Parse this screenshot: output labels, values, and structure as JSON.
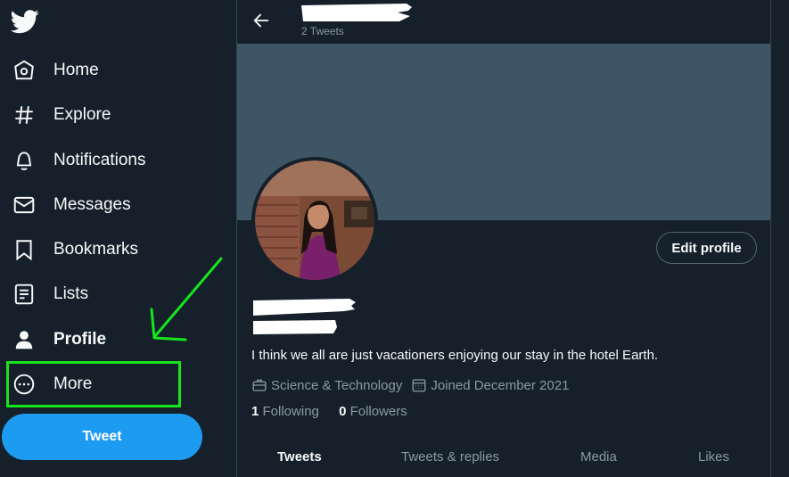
{
  "nav": {
    "items": [
      {
        "label": "Home",
        "icon": "home-icon"
      },
      {
        "label": "Explore",
        "icon": "hashtag-icon"
      },
      {
        "label": "Notifications",
        "icon": "bell-icon"
      },
      {
        "label": "Messages",
        "icon": "envelope-icon"
      },
      {
        "label": "Bookmarks",
        "icon": "bookmark-icon"
      },
      {
        "label": "Lists",
        "icon": "list-icon"
      },
      {
        "label": "Profile",
        "icon": "person-icon"
      },
      {
        "label": "More",
        "icon": "more-circle-icon"
      }
    ],
    "tweet_label": "Tweet"
  },
  "header": {
    "tweet_count": "2 Tweets"
  },
  "profile": {
    "edit_label": "Edit profile",
    "bio": "I think we all are just vacationers enjoying our stay in the hotel Earth.",
    "category": "Science & Technology",
    "joined": "Joined December 2021",
    "following_count": "1",
    "following_label": "Following",
    "followers_count": "0",
    "followers_label": "Followers"
  },
  "tabs": [
    "Tweets",
    "Tweets & replies",
    "Media",
    "Likes"
  ],
  "colors": {
    "background": "#15202b",
    "banner": "#3e5566",
    "accent": "#1d9bf0",
    "annotation": "#16e41d",
    "muted_text": "#8b98a5"
  }
}
